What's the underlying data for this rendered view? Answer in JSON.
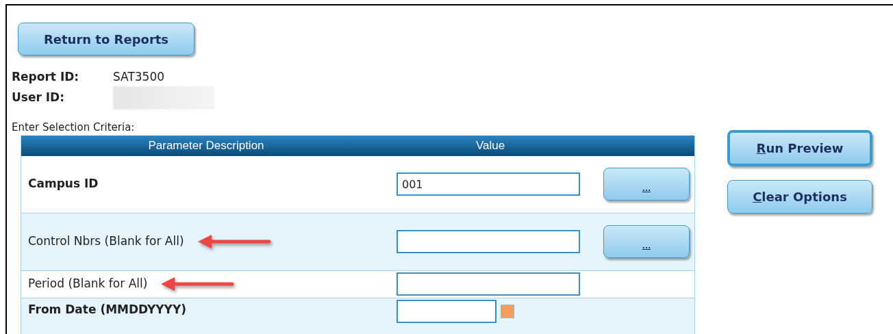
{
  "top_button": {
    "label": "Return to Reports"
  },
  "info": [
    {
      "label": "Report ID:",
      "value": "SAT3500",
      "redacted": false
    },
    {
      "label": "User ID:",
      "redacted": true
    }
  ],
  "criteria_title": "Enter Selection Criteria:",
  "table": {
    "columns": [
      "Parameter Description",
      "Value"
    ],
    "rows": [
      {
        "label": "Campus ID",
        "bold": true,
        "kind": "lookup",
        "value": "001",
        "button": "...",
        "arrow": false
      },
      {
        "label": "Control Nbrs (Blank for All)",
        "bold": false,
        "kind": "lookup",
        "value": "",
        "button": "...",
        "arrow": true
      },
      {
        "label": "Period (Blank for All)",
        "bold": false,
        "kind": "text",
        "value": "",
        "arrow": true
      },
      {
        "label": "From Date (MMDDYYYY)",
        "bold": true,
        "kind": "date",
        "value": "",
        "arrow": false
      }
    ]
  },
  "side_buttons": [
    {
      "access_key": "R",
      "label_rest": "un Preview",
      "focused": true
    },
    {
      "access_key": "C",
      "label_rest": "lear Options",
      "focused": false
    }
  ]
}
